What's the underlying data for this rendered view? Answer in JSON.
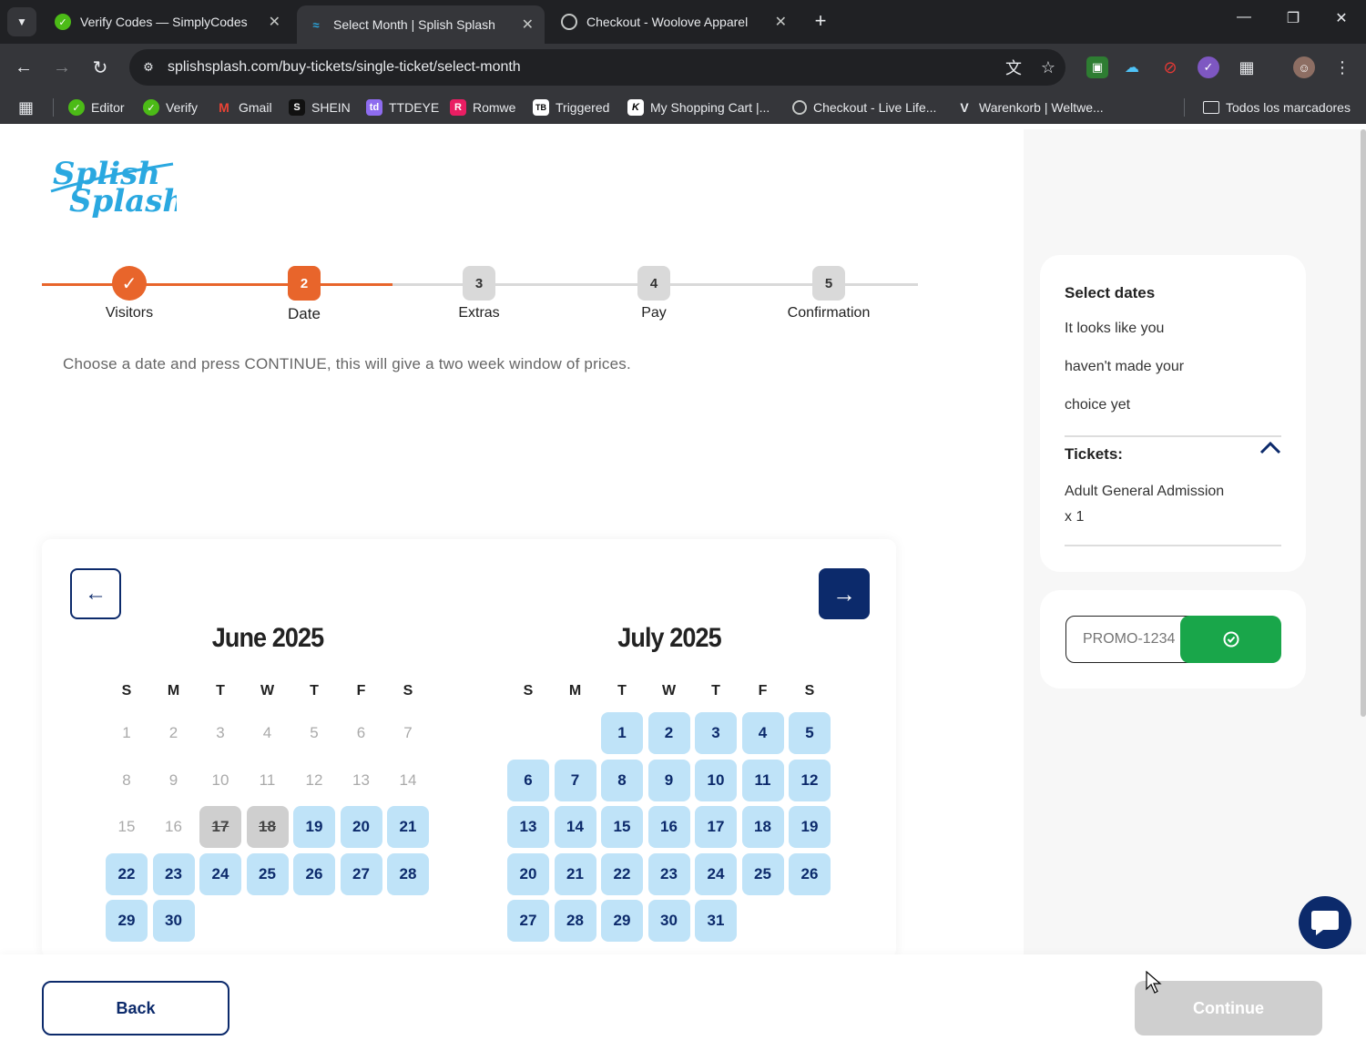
{
  "browser": {
    "tabs": [
      {
        "title": "Verify Codes — SimplyCodes",
        "active": false
      },
      {
        "title": "Select Month | Splish Splash",
        "active": true
      },
      {
        "title": "Checkout - Woolove Apparel",
        "active": false
      }
    ],
    "url": "splishsplash.com/buy-tickets/single-ticket/select-month",
    "bookmarks": [
      {
        "label": "Editor"
      },
      {
        "label": "Verify"
      },
      {
        "label": "Gmail"
      },
      {
        "label": "SHEIN"
      },
      {
        "label": "TTDEYE"
      },
      {
        "label": "Romwe"
      },
      {
        "label": "Triggered"
      },
      {
        "label": "My Shopping Cart |..."
      },
      {
        "label": "Checkout - Live Life..."
      },
      {
        "label": "Warenkorb | Weltwe..."
      }
    ],
    "all_bookmarks": "Todos los marcadores"
  },
  "logo_text": "Splish Splash",
  "stepper": [
    {
      "number": "✓",
      "label": "Visitors",
      "state": "done"
    },
    {
      "number": "2",
      "label": "Date",
      "state": "current"
    },
    {
      "number": "3",
      "label": "Extras",
      "state": "pending"
    },
    {
      "number": "4",
      "label": "Pay",
      "state": "pending"
    },
    {
      "number": "5",
      "label": "Confirmation",
      "state": "pending"
    }
  ],
  "instructions": "Choose a date and press CONTINUE, this will give a two week window of prices.",
  "calendar": {
    "weekdays": [
      "S",
      "M",
      "T",
      "W",
      "T",
      "F",
      "S"
    ],
    "months": [
      {
        "title": "June 2025",
        "first_weekday": 0,
        "days": 30,
        "past_through": 16,
        "sold_out": [
          17,
          18
        ]
      },
      {
        "title": "July 2025",
        "first_weekday": 2,
        "days": 31,
        "past_through": 0,
        "sold_out": []
      }
    ]
  },
  "summary": {
    "title": "Select dates",
    "line1": "It looks like you",
    "line2": "haven't made your",
    "line3": "choice yet",
    "tickets_label": "Tickets:",
    "ticket_name": "Adult General Admission",
    "ticket_qty": "x 1"
  },
  "promo": {
    "placeholder": "PROMO-1234"
  },
  "footer": {
    "back_label": "Back",
    "continue_label": "Continue"
  },
  "colors": {
    "accent_orange": "#e8652b",
    "navy": "#0c2a6b",
    "available_day": "#bfe3f8",
    "promo_green": "#19a64a",
    "logo_blue": "#2aa8e0"
  }
}
